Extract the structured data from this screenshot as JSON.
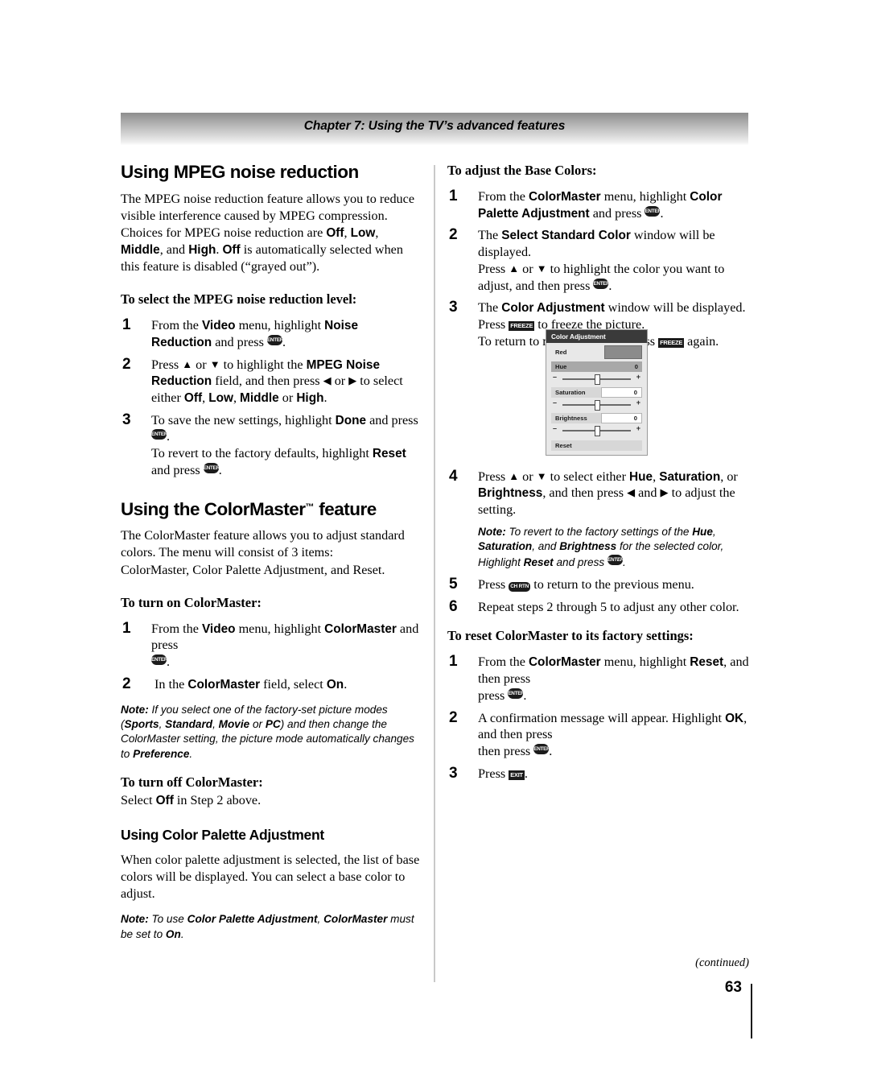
{
  "header": {
    "chapter_title": "Chapter 7: Using the TV’s advanced features"
  },
  "left_column": {
    "section1_heading": "Using MPEG noise reduction",
    "section1_body_1": "The MPEG noise reduction feature allows you to reduce visible interference caused by MPEG compression. Choices for MPEG noise reduction are ",
    "section1_body_opt1": "Off",
    "section1_body_opt2": "Low",
    "section1_body_opt3": "Middle",
    "section1_body_opt4": "High",
    "section1_body_2": "is automatically selected when this feature is disabled (“grayed out”).",
    "proc1_heading": "To select the MPEG noise reduction level:",
    "proc1_steps": [
      {
        "num": "1",
        "parts": [
          "From the ",
          "Video",
          " menu, highlight ",
          "Noise Reduction",
          " and press ",
          "ENTER",
          "."
        ]
      },
      {
        "num": "2",
        "parts": [
          "Press ",
          "▲",
          " or ",
          "▼",
          " to highlight the ",
          "MPEG Noise Reduction",
          " field, and then press ",
          "◀",
          " or ",
          "▶",
          " to select either ",
          "Off",
          ", ",
          "Low",
          ", ",
          "Middle",
          " or ",
          "High",
          "."
        ]
      },
      {
        "num": "3",
        "line1": "To save the new settings, highlight Done and press ENTER.",
        "line2": "To revert to the factory defaults, highlight Reset and press ENTER."
      }
    ],
    "section2_heading": "Using the ColorMaster",
    "section2_heading_tm": "™",
    "section2_heading_rest": " feature",
    "section2_body": "The ColorMaster feature allows you to adjust standard colors. The menu will consist of 3 items:",
    "section2_body_line2": "ColorMaster, Color Palette Adjustment, and Reset.",
    "proc2_heading": "To turn on ColorMaster:",
    "proc2_step1_num": "1",
    "proc2_step1_a": "From the ",
    "proc2_step1_b": "Video",
    "proc2_step1_c": " menu, highlight ",
    "proc2_step1_d": "ColorMaster",
    "proc2_step1_e": " and press ",
    "proc2_step1_key": "ENTER",
    "proc2_step2_num": "2",
    "proc2_step2_a": "In the ",
    "proc2_step2_b": "ColorMaster",
    "proc2_step2_c": " field, select ",
    "proc2_step2_d": "On",
    "note1_label": "Note:",
    "note1_a": " If you select one of the factory-set picture modes (",
    "note1_m1": "Sports",
    "note1_m2": "Standard",
    "note1_m3": "Movie",
    "note1_m4": "PC",
    "note1_b": ") and then change the ColorMaster setting, the picture mode automatically changes to ",
    "note1_c": "Preference",
    "proc3_heading": "To turn off ColorMaster:",
    "proc3_a": "Select ",
    "proc3_b": "Off",
    "proc3_c": " in Step 2 above.",
    "section3_heading": "Using Color Palette Adjustment",
    "section3_body": "When color palette adjustment is selected, the list of base colors will be displayed. You can select a base color to adjust.",
    "note2_label": "Note:",
    "note2_a": " To use ",
    "note2_b": "Color Palette Adjustment",
    "note2_c": ", ",
    "note2_d": "ColorMaster",
    "note2_e": " must be set to ",
    "note2_f": "On"
  },
  "right_column": {
    "proc4_heading": "To adjust the Base Colors:",
    "step1_num": "1",
    "step1_a": "From the ",
    "step1_b": "ColorMaster",
    "step1_c": " menu, highlight ",
    "step1_d": "Color Palette Adjustment",
    "step1_e": " and press ",
    "step1_key": "ENTER",
    "step2_num": "2",
    "step2_a": "The ",
    "step2_b": "Select Standard Color",
    "step2_c": " window will be displayed.",
    "step2_d": "Press ",
    "step2_up": "▲",
    "step2_e": " or ",
    "step2_dn": "▼",
    "step2_f": " to highlight the color you want to adjust, and then press ",
    "step2_key": "ENTER",
    "step3_num": "3",
    "step3_a": "The ",
    "step3_b": "Color Adjustment",
    "step3_c": " window will be displayed.",
    "step3_d": "Press ",
    "step3_key1": "FREEZE",
    "step3_e": " to freeze the picture.",
    "step3_f": "To return to moving picture, press ",
    "step3_key2": "FREEZE",
    "step3_g": " again.",
    "step4_num": "4",
    "step4_a": "Press ",
    "step4_up": "▲",
    "step4_b": " or ",
    "step4_dn": "▼",
    "step4_c": " to select either ",
    "step4_d": "Hue",
    "step4_e": ", ",
    "step4_f": "Saturation",
    "step4_g": ", or ",
    "step4_h": "Brightness",
    "step4_i": ", and then press ",
    "step4_lt": "◀",
    "step4_j": " and ",
    "step4_rt": "▶",
    "step4_k": " to adjust the setting.",
    "note3_label": "Note:",
    "note3_a": " To revert to the factory settings of the ",
    "note3_b": "Hue",
    "note3_c": ", ",
    "note3_d": "Saturation",
    "note3_e": ", and ",
    "note3_f": "Brightness",
    "note3_g": " for the selected color, Highlight ",
    "note3_h": "Reset",
    "note3_i": " and press ",
    "note3_key": "ENTER",
    "step5_num": "5",
    "step5_a": "Press ",
    "step5_key": "CH RTN",
    "step5_b": " to return to the previous menu.",
    "step6_num": "6",
    "step6_a": "Repeat steps 2 through 5 to adjust any other color.",
    "proc5_heading": "To reset ColorMaster to its factory settings:",
    "r1_num": "1",
    "r1_a": "From the ",
    "r1_b": "ColorMaster",
    "r1_c": " menu, highlight ",
    "r1_d": "Reset",
    "r1_e": ", and then press ",
    "r1_key": "ENTER",
    "r2_num": "2",
    "r2_a": "A confirmation message will appear. Highlight ",
    "r2_b": "OK",
    "r2_c": ", and then press ",
    "r2_key": "ENTER",
    "r3_num": "3",
    "r3_a": "Press ",
    "r3_key": "EXIT",
    "r3_b": "."
  },
  "osd_menu": {
    "title": "Color Adjustment",
    "color_label": "Red",
    "rows": [
      {
        "label": "Hue",
        "value": "0",
        "highlighted": true
      },
      {
        "label": "Saturation",
        "value": "0",
        "highlighted": false
      },
      {
        "label": "Brightness",
        "value": "0",
        "highlighted": false
      }
    ],
    "minus": "–",
    "plus": "+",
    "reset_label": "Reset",
    "swatch_color": "#8b8b8b",
    "title_bg": "#3a3a3a",
    "panel_bg": "#e8e8e8"
  },
  "footer": {
    "continued": "(continued)",
    "page_number": "63"
  }
}
